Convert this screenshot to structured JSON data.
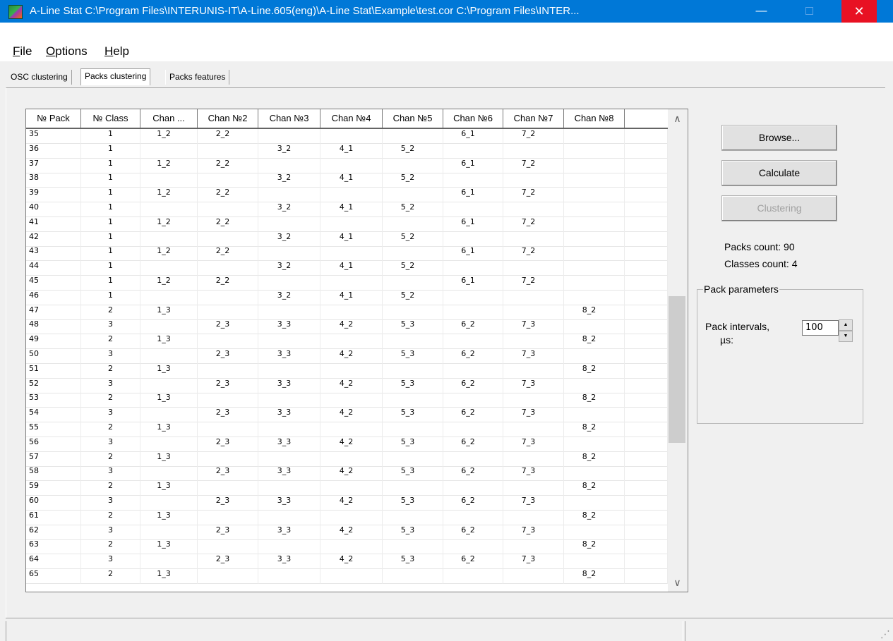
{
  "window": {
    "title": "A-Line Stat   C:\\Program Files\\INTERUNIS-IT\\A-Line.605(eng)\\A-Line Stat\\Example\\test.cor   C:\\Program Files\\INTER...",
    "minimize": "—",
    "close": "✕"
  },
  "menu": {
    "file": "File",
    "options": "Options",
    "help": "Help"
  },
  "tabs": {
    "osc": "OSC clustering",
    "packs": "Packs clustering",
    "features": "Packs features"
  },
  "grid": {
    "columns": [
      "№ Pack",
      "№ Class",
      "Chan ...",
      "Chan №2",
      "Chan №3",
      "Chan №4",
      "Chan №5",
      "Chan №6",
      "Chan №7",
      "Chan №8"
    ],
    "rows": [
      [
        "35",
        "1",
        "1_2",
        "2_2",
        "",
        "",
        "",
        "6_1",
        "7_2",
        ""
      ],
      [
        "36",
        "1",
        "",
        "",
        "3_2",
        "4_1",
        "5_2",
        "",
        "",
        ""
      ],
      [
        "37",
        "1",
        "1_2",
        "2_2",
        "",
        "",
        "",
        "6_1",
        "7_2",
        ""
      ],
      [
        "38",
        "1",
        "",
        "",
        "3_2",
        "4_1",
        "5_2",
        "",
        "",
        ""
      ],
      [
        "39",
        "1",
        "1_2",
        "2_2",
        "",
        "",
        "",
        "6_1",
        "7_2",
        ""
      ],
      [
        "40",
        "1",
        "",
        "",
        "3_2",
        "4_1",
        "5_2",
        "",
        "",
        ""
      ],
      [
        "41",
        "1",
        "1_2",
        "2_2",
        "",
        "",
        "",
        "6_1",
        "7_2",
        ""
      ],
      [
        "42",
        "1",
        "",
        "",
        "3_2",
        "4_1",
        "5_2",
        "",
        "",
        ""
      ],
      [
        "43",
        "1",
        "1_2",
        "2_2",
        "",
        "",
        "",
        "6_1",
        "7_2",
        ""
      ],
      [
        "44",
        "1",
        "",
        "",
        "3_2",
        "4_1",
        "5_2",
        "",
        "",
        ""
      ],
      [
        "45",
        "1",
        "1_2",
        "2_2",
        "",
        "",
        "",
        "6_1",
        "7_2",
        ""
      ],
      [
        "46",
        "1",
        "",
        "",
        "3_2",
        "4_1",
        "5_2",
        "",
        "",
        ""
      ],
      [
        "47",
        "2",
        "1_3",
        "",
        "",
        "",
        "",
        "",
        "",
        "8_2"
      ],
      [
        "48",
        "3",
        "",
        "2_3",
        "3_3",
        "4_2",
        "5_3",
        "6_2",
        "7_3",
        ""
      ],
      [
        "49",
        "2",
        "1_3",
        "",
        "",
        "",
        "",
        "",
        "",
        "8_2"
      ],
      [
        "50",
        "3",
        "",
        "2_3",
        "3_3",
        "4_2",
        "5_3",
        "6_2",
        "7_3",
        ""
      ],
      [
        "51",
        "2",
        "1_3",
        "",
        "",
        "",
        "",
        "",
        "",
        "8_2"
      ],
      [
        "52",
        "3",
        "",
        "2_3",
        "3_3",
        "4_2",
        "5_3",
        "6_2",
        "7_3",
        ""
      ],
      [
        "53",
        "2",
        "1_3",
        "",
        "",
        "",
        "",
        "",
        "",
        "8_2"
      ],
      [
        "54",
        "3",
        "",
        "2_3",
        "3_3",
        "4_2",
        "5_3",
        "6_2",
        "7_3",
        ""
      ],
      [
        "55",
        "2",
        "1_3",
        "",
        "",
        "",
        "",
        "",
        "",
        "8_2"
      ],
      [
        "56",
        "3",
        "",
        "2_3",
        "3_3",
        "4_2",
        "5_3",
        "6_2",
        "7_3",
        ""
      ],
      [
        "57",
        "2",
        "1_3",
        "",
        "",
        "",
        "",
        "",
        "",
        "8_2"
      ],
      [
        "58",
        "3",
        "",
        "2_3",
        "3_3",
        "4_2",
        "5_3",
        "6_2",
        "7_3",
        ""
      ],
      [
        "59",
        "2",
        "1_3",
        "",
        "",
        "",
        "",
        "",
        "",
        "8_2"
      ],
      [
        "60",
        "3",
        "",
        "2_3",
        "3_3",
        "4_2",
        "5_3",
        "6_2",
        "7_3",
        ""
      ],
      [
        "61",
        "2",
        "1_3",
        "",
        "",
        "",
        "",
        "",
        "",
        "8_2"
      ],
      [
        "62",
        "3",
        "",
        "2_3",
        "3_3",
        "4_2",
        "5_3",
        "6_2",
        "7_3",
        ""
      ],
      [
        "63",
        "2",
        "1_3",
        "",
        "",
        "",
        "",
        "",
        "",
        "8_2"
      ],
      [
        "64",
        "3",
        "",
        "2_3",
        "3_3",
        "4_2",
        "5_3",
        "6_2",
        "7_3",
        ""
      ],
      [
        "65",
        "2",
        "1_3",
        "",
        "",
        "",
        "",
        "",
        "",
        "8_2"
      ]
    ]
  },
  "scroll": {
    "up": "∧",
    "down": "∨"
  },
  "buttons": {
    "browse": "Browse...",
    "calculate": "Calculate",
    "clustering": "Clustering"
  },
  "stats": {
    "packs_count": "Packs count: 90",
    "classes_count": "Classes count: 4"
  },
  "pack_parameters": {
    "title": "Pack parameters",
    "interval_label": "Pack intervals,",
    "interval_unit": "µs:",
    "interval_value": "100",
    "spin_up": "▲",
    "spin_down": "▼"
  },
  "statusbar": {
    "grip": "⋰"
  }
}
